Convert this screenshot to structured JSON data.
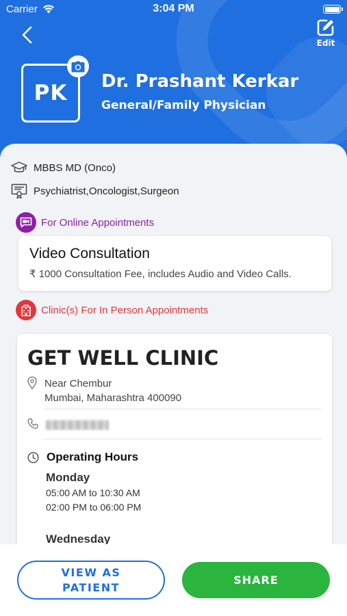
{
  "status_bar": {
    "carrier": "Carrier",
    "time": "3:04 PM"
  },
  "header": {
    "back_icon": "chevron-left-icon",
    "edit_icon": "edit-square-icon",
    "edit_label": "Edit",
    "avatar_initials": "PK",
    "camera_icon": "camera-icon",
    "doctor_name": "Dr. Prashant Kerkar",
    "specialty": "General/Family Physician"
  },
  "profile": {
    "qualification": "MBBS MD (Onco)",
    "qualification_icon": "graduation-cap-icon",
    "specializations": "Psychiatrist,Oncologist,Surgeon",
    "specializations_icon": "certificate-icon"
  },
  "online": {
    "section_title": "For Online Appointments",
    "icon": "video-chat-icon",
    "card_title": "Video Consultation",
    "fee_text": "₹ 1000 Consultation Fee, includes Audio and Video Calls."
  },
  "clinics": {
    "section_title": "Clinic(s) For In Person Appointments",
    "icon": "hospital-icon",
    "clinic": {
      "name": "GET WELL CLINIC",
      "address_line1": "Near Chembur",
      "address_line2": "Mumbai, Maharashtra 400090",
      "location_icon": "location-pin-icon",
      "phone_icon": "phone-icon",
      "clock_icon": "clock-icon",
      "hours_title": "Operating Hours",
      "days": [
        {
          "day": "Monday",
          "slots": [
            "05:00 AM to 10:30 AM",
            "02:00 PM to 06:00 PM"
          ]
        },
        {
          "day": "Wednesday",
          "slots": []
        }
      ]
    }
  },
  "actions": {
    "view_as_patient": "VIEW AS PATIENT",
    "share": "SHARE"
  },
  "colors": {
    "primary_blue": "#1f6fe0",
    "share_green": "#2bb53f",
    "online_purple": "#8e1fa8",
    "clinic_red": "#e0383c"
  }
}
